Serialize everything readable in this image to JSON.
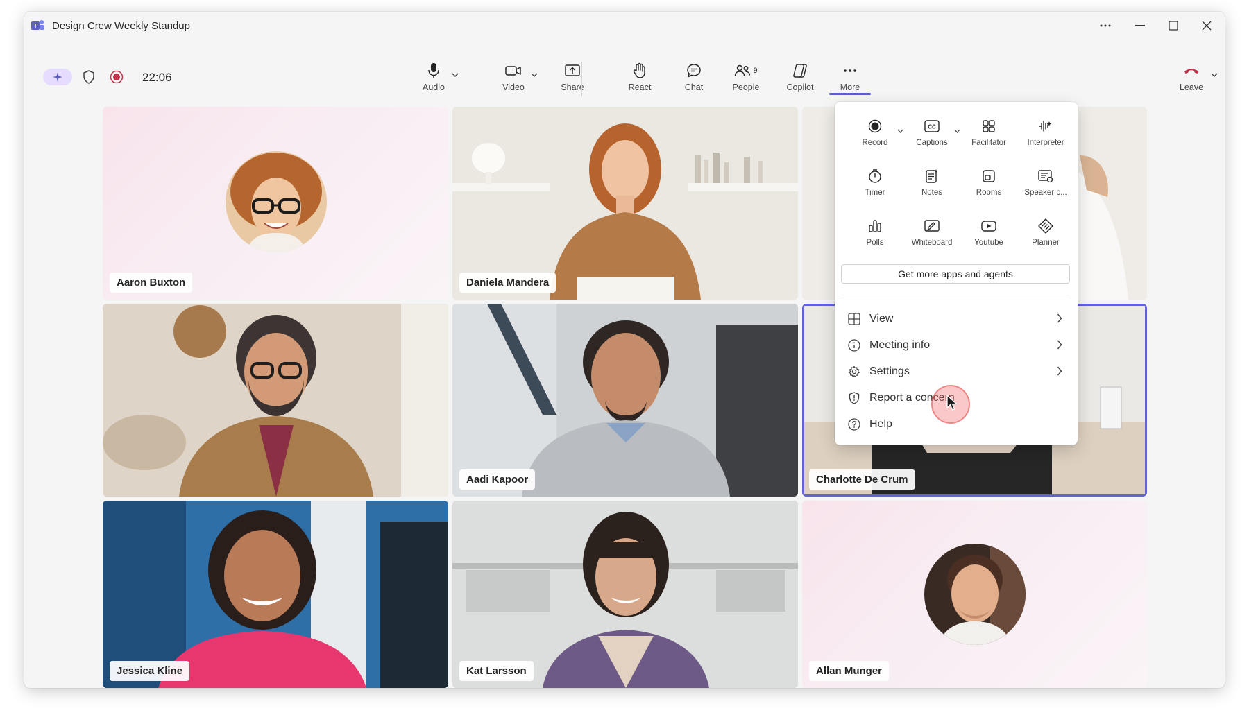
{
  "window": {
    "title": "Design Crew Weekly Standup",
    "controls": [
      "more-options",
      "minimize",
      "maximize",
      "close"
    ]
  },
  "toolbar": {
    "timer": "22:06",
    "tools": [
      {
        "id": "audio",
        "label": "Audio",
        "icon": "microphone-icon"
      },
      {
        "id": "video",
        "label": "Video",
        "icon": "video-camera-icon"
      },
      {
        "id": "share",
        "label": "Share",
        "icon": "share-screen-icon"
      },
      {
        "id": "react",
        "label": "React",
        "icon": "raise-hand-icon"
      },
      {
        "id": "chat",
        "label": "Chat",
        "icon": "chat-bubble-icon"
      },
      {
        "id": "people",
        "label": "People",
        "icon": "people-icon",
        "count": "9"
      },
      {
        "id": "copilot",
        "label": "Copilot",
        "icon": "copilot-icon"
      },
      {
        "id": "more",
        "label": "More",
        "icon": "ellipsis-icon",
        "active": true
      },
      {
        "id": "leave",
        "label": "Leave",
        "icon": "hang-up-icon"
      }
    ],
    "accent_color": "#5b5fc7",
    "leave_color": "#c4314b"
  },
  "participants": [
    {
      "name": "Aaron Buxton",
      "kind": "avatar"
    },
    {
      "name": "Daniela Mandera",
      "kind": "video"
    },
    {
      "name": "Aadi Kapoor",
      "kind": "video"
    },
    {
      "name": "Charlotte De Crum",
      "kind": "video",
      "active_speaker": true
    },
    {
      "name": "Jessica Kline",
      "kind": "video"
    },
    {
      "name": "Kat Larsson",
      "kind": "video"
    },
    {
      "name": "Allan Munger",
      "kind": "avatar"
    }
  ],
  "more_menu": {
    "apps": [
      {
        "label": "Record",
        "icon": "record-icon",
        "has_caret": true
      },
      {
        "label": "Captions",
        "icon": "captions-icon",
        "has_caret": true
      },
      {
        "label": "Facilitator",
        "icon": "facilitator-icon"
      },
      {
        "label": "Interpreter",
        "icon": "interpreter-icon"
      },
      {
        "label": "Timer",
        "icon": "timer-icon"
      },
      {
        "label": "Notes",
        "icon": "notes-icon"
      },
      {
        "label": "Rooms",
        "icon": "rooms-icon"
      },
      {
        "label": "Speaker c...",
        "icon": "speaker-coach-icon"
      },
      {
        "label": "Polls",
        "icon": "polls-icon"
      },
      {
        "label": "Whiteboard",
        "icon": "whiteboard-icon"
      },
      {
        "label": "Youtube",
        "icon": "youtube-icon"
      },
      {
        "label": "Planner",
        "icon": "planner-icon"
      }
    ],
    "get_more_label": "Get more apps and agents",
    "items": [
      {
        "label": "View",
        "icon": "grid-view-icon",
        "submenu": true
      },
      {
        "label": "Meeting info",
        "icon": "info-icon",
        "submenu": true
      },
      {
        "label": "Settings",
        "icon": "gear-icon",
        "submenu": true
      },
      {
        "label": "Report a concern",
        "icon": "shield-icon",
        "submenu": false
      },
      {
        "label": "Help",
        "icon": "help-icon",
        "submenu": false
      }
    ]
  }
}
